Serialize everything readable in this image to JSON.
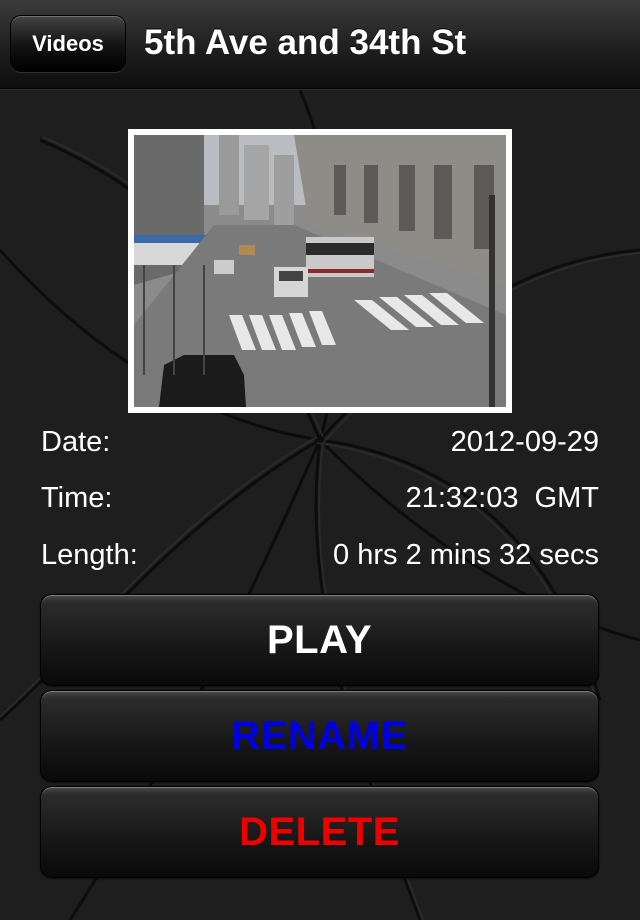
{
  "nav": {
    "back_label": "Videos",
    "title": "5th Ave and 34th St"
  },
  "video_thumbnail": {
    "icon": "street-camera-thumbnail"
  },
  "details": {
    "date_label": "Date:",
    "date_value": "2012-09-29",
    "time_label": "Time:",
    "time_value": "21:32:03  GMT",
    "length_label": "Length:",
    "length_value": "0 hrs 2 mins 32 secs"
  },
  "actions": {
    "play_label": "PLAY",
    "rename_label": "RENAME",
    "delete_label": "DELETE"
  },
  "colors": {
    "play_text": "#ffffff",
    "rename_text": "#0000e0",
    "delete_text": "#ee0000",
    "background": "#1c1c1c"
  }
}
